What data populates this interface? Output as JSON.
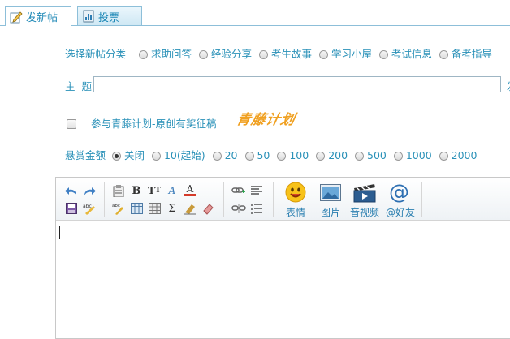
{
  "tabs": [
    {
      "label": "发新帖",
      "icon": "edit-post-icon",
      "active": true
    },
    {
      "label": "投票",
      "icon": "vote-icon",
      "active": false
    }
  ],
  "category": {
    "label": "选择新帖分类",
    "options": [
      "求助问答",
      "经验分享",
      "考生故事",
      "学习小屋",
      "考试信息",
      "备考指导"
    ]
  },
  "subject": {
    "label": "主  题",
    "value": "",
    "trailing": "发"
  },
  "plan": {
    "checkbox_label": "参与青藤计划-原创有奖征稿",
    "logo_text": "青藤计划",
    "checked": false
  },
  "reward": {
    "label": "悬赏金额",
    "options": [
      "关闭",
      "10(起始)",
      "20",
      "50",
      "100",
      "200",
      "500",
      "1000",
      "2000"
    ],
    "selected": "关闭"
  },
  "editor": {
    "toolbar_big": [
      {
        "caption": "表情",
        "icon": "smiley-icon"
      },
      {
        "caption": "图片",
        "icon": "picture-icon"
      },
      {
        "caption": "音视频",
        "icon": "video-icon"
      },
      {
        "caption": "@好友",
        "icon": "at-icon"
      }
    ],
    "content": ""
  },
  "colors": {
    "label_blue": "#2a91b8",
    "tab_border": "#8dbfd9",
    "logo_orange": "#f0a020"
  }
}
